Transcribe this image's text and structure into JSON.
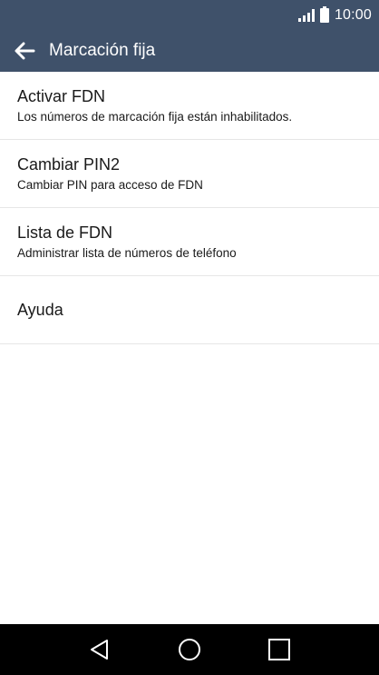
{
  "status_bar": {
    "time": "10:00"
  },
  "app_bar": {
    "title": "Marcación fija",
    "back_icon": "arrow-left-icon"
  },
  "settings": [
    {
      "title": "Activar FDN",
      "subtitle": "Los números de marcación fija están inhabilitados."
    },
    {
      "title": "Cambiar PIN2",
      "subtitle": "Cambiar PIN para acceso de FDN"
    },
    {
      "title": "Lista de FDN",
      "subtitle": "Administrar lista de números de teléfono"
    },
    {
      "title": "Ayuda"
    }
  ],
  "nav_bar": {
    "icons": [
      "back-triangle-icon",
      "home-circle-icon",
      "recents-square-icon"
    ]
  },
  "colors": {
    "app_bar": "#3f516a",
    "nav_bar": "#000000",
    "divider": "#e6e6e6"
  }
}
